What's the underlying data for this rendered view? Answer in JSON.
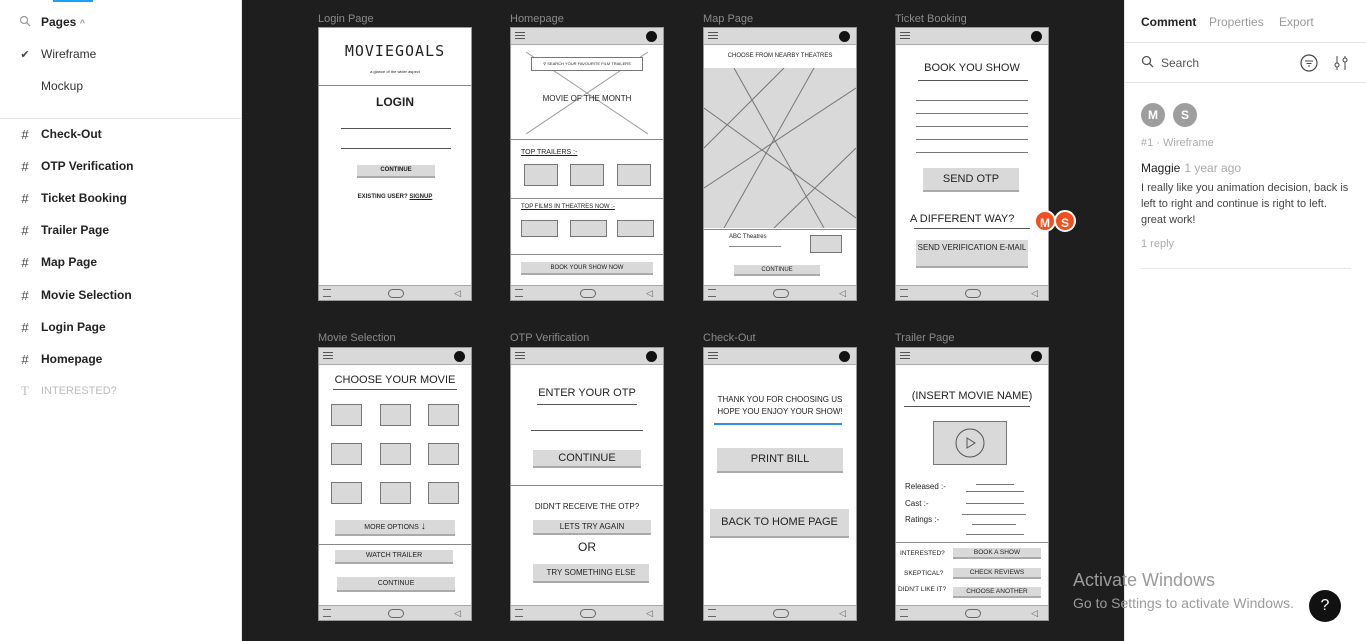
{
  "left_panel": {
    "pages_header": "Pages",
    "pages": [
      {
        "label": "Wireframe",
        "selected": true
      },
      {
        "label": "Mockup",
        "selected": false
      }
    ],
    "layers": [
      "Check-Out",
      "OTP Verification",
      "Ticket Booking",
      "Trailer Page",
      "Map Page",
      "Movie Selection",
      "Login Page",
      "Homepage"
    ],
    "text_layer": "INTERESTED?"
  },
  "right_panel": {
    "tabs": [
      "Comment",
      "Properties",
      "Export"
    ],
    "search_placeholder": "Search",
    "avatars": [
      "M",
      "S"
    ],
    "comment": {
      "meta": "#1 · Wireframe",
      "author": "Maggie",
      "time": "1 year ago",
      "body": "I really like you animation decision, back is left to right and continue is right to left. great work!",
      "replies": "1 reply"
    }
  },
  "canvas": {
    "frame_titles": [
      "Login Page",
      "Homepage",
      "Map Page",
      "Ticket Booking",
      "Movie Selection",
      "OTP Verification",
      "Check-Out",
      "Trailer Page"
    ],
    "login": {
      "logo": "MOVIEGOALS",
      "tagline": "a glance of the wider aspect",
      "title": "LOGIN",
      "continue": "CONTINUE",
      "existing": "EXISTING USER?",
      "signup": "SIGNUP"
    },
    "home": {
      "search": "SEARCH YOUR FAVOURITE FILM TRAILERS",
      "motm": "MOVIE OF THE MONTH",
      "trailers": "TOP TRAILERS :-",
      "films": "TOP FILMS IN THEATRES NOW :-",
      "book": "BOOK YOUR SHOW NOW"
    },
    "map": {
      "choose": "CHOOSE FROM NEARBY THEATRES",
      "theatre": "ABC Theatres",
      "continue": "CONTINUE"
    },
    "ticket": {
      "title": "BOOK YOU SHOW",
      "otp": "SEND OTP",
      "diff": "A DIFFERENT WAY?",
      "verify": "SEND VERIFICATION E-MAIL"
    },
    "movie": {
      "title": "CHOOSE YOUR MOVIE",
      "more": "MORE OPTIONS",
      "watch": "WATCH TRAILER",
      "continue": "CONTINUE"
    },
    "otp": {
      "title": "ENTER YOUR OTP",
      "continue": "CONTINUE",
      "didnt": "DIDN'T RECEIVE  THE OTP?",
      "again": "LETS TRY AGAIN",
      "or": "OR",
      "else": "TRY SOMETHING ELSE"
    },
    "checkout": {
      "thanks1": "THANK YOU FOR CHOOSING US",
      "thanks2": "HOPE YOU ENJOY YOUR SHOW!",
      "print": "PRINT BILL",
      "back": "BACK TO HOME PAGE"
    },
    "trailer": {
      "title": "(INSERT MOVIE NAME)",
      "released": "Released :-",
      "cast": "Cast :-",
      "ratings": "Ratings :-",
      "interested": "INTERESTED?",
      "book": "BOOK A SHOW",
      "skeptical": "SKEPTICAL?",
      "reviews": "CHECK REVIEWS",
      "dislike": "DIDN'T LIKE IT?",
      "another": "CHOOSE ANOTHER"
    },
    "cursor_avatars": [
      "M",
      "S"
    ]
  },
  "watermark": {
    "line1": "Activate Windows",
    "line2": "Go to Settings to activate Windows."
  },
  "help_label": "?"
}
